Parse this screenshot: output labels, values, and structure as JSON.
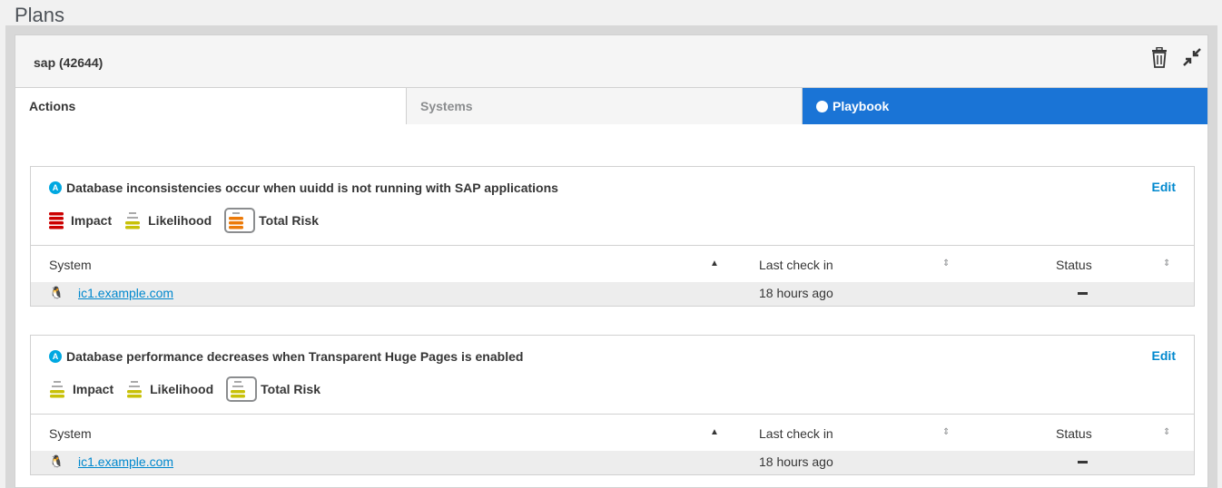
{
  "page": {
    "title": "Plans"
  },
  "plan": {
    "name": "sap (42644)"
  },
  "icons": {
    "delete": "trash-icon",
    "collapse": "compress-icon",
    "system": "linux-icon",
    "category": "availability-icon"
  },
  "tabs": [
    {
      "label": "Actions",
      "active": true
    },
    {
      "label": "Systems",
      "active": false
    },
    {
      "label": "Playbook",
      "active": false
    }
  ],
  "colors": {
    "high": "#cc0000",
    "medium": "#ec7a08",
    "low": "#c8c108",
    "primary": "#1a74d6",
    "link": "#0088ce"
  },
  "actions": [
    {
      "badge": "A",
      "title": "Database inconsistencies occur when uuidd is not running with SAP applications",
      "edit_label": "Edit",
      "impact": {
        "label": "Impact",
        "level": "high"
      },
      "likelihood": {
        "label": "Likelihood",
        "level": "low"
      },
      "total_risk": {
        "label": "Total Risk",
        "level": "medium"
      },
      "columns": [
        "System",
        "Last check in",
        "Status"
      ],
      "rows": [
        {
          "system": "ic1.example.com",
          "last_check_in": "18 hours ago",
          "status": "—"
        }
      ]
    },
    {
      "badge": "A",
      "title": "Database performance decreases when Transparent Huge Pages is enabled",
      "edit_label": "Edit",
      "impact": {
        "label": "Impact",
        "level": "low"
      },
      "likelihood": {
        "label": "Likelihood",
        "level": "low"
      },
      "total_risk": {
        "label": "Total Risk",
        "level": "low"
      },
      "columns": [
        "System",
        "Last check in",
        "Status"
      ],
      "rows": [
        {
          "system": "ic1.example.com",
          "last_check_in": "18 hours ago",
          "status": "—"
        }
      ]
    }
  ]
}
